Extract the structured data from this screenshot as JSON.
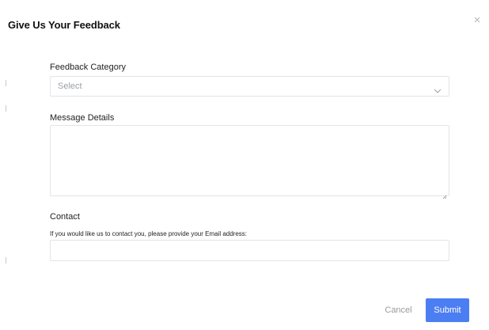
{
  "dialog": {
    "title": "Give Us Your Feedback",
    "close_icon": "close-icon"
  },
  "form": {
    "category": {
      "label": "Feedback Category",
      "selected": "Select",
      "icon": "chevron-down-icon"
    },
    "message": {
      "label": "Message Details",
      "value": ""
    },
    "contact": {
      "label": "Contact",
      "helper": "If you would like us to contact you, please provide your Email address:",
      "value": ""
    }
  },
  "actions": {
    "cancel_label": "Cancel",
    "submit_label": "Submit"
  },
  "colors": {
    "submit_bg": "#4c7ef3",
    "border": "#e2e4e8",
    "muted_text": "#9a9a9a"
  }
}
